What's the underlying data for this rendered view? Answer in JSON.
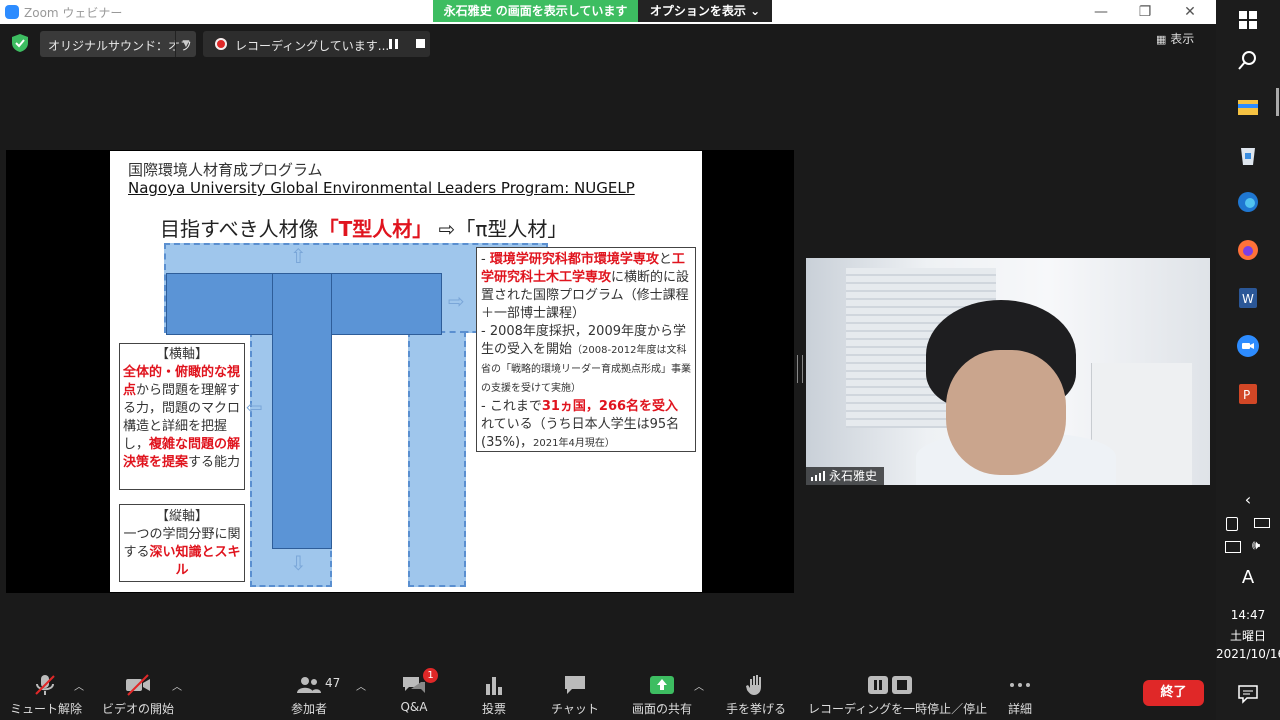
{
  "window": {
    "title": "Zoom ウェビナー",
    "share_banner": "永石雅史 の画面を表示しています",
    "options_label": "オプションを表示"
  },
  "meeting_toolbar": {
    "audio_label": "オリジナルサウンド：オフ",
    "recording_label": "レコーディングしています...",
    "view_label": "表示"
  },
  "slide": {
    "title_jp": "国際環境人材育成プログラム",
    "title_en": "Nagoya University Global Environmental Leaders Program: NUGELP",
    "heading_prefix": "目指すべき人材像",
    "heading_red": "「T型人材」",
    "heading_arrow": "⇨",
    "heading_suffix": "「π型人材」",
    "horizontal_box": {
      "title": "【横軸】",
      "red1": "全体的・俯瞰的な視点",
      "text1": "から問題を理解する力，問題のマクロ構造と詳細を把握し，",
      "red2": "複雑な問題の解決策を提案",
      "text2": "する能力"
    },
    "vertical_box": {
      "title": "【縦軸】",
      "text1": "一つの学問分野に関する",
      "red1": "深い知識とスキル"
    },
    "info_box": {
      "dash1": "- ",
      "red1": "環境学研究科都市環境学専攻",
      "text1": "と",
      "red2": "工学研究科土木工学専攻",
      "text2": "に横断的に設置された国際プログラム（修士課程＋一部博士課程）",
      "text3": "- 2008年度採択，2009年度から学生の受入を開始",
      "small1": "（2008-2012年度は文科省の「戦略的環境リーダー育成拠点形成」事業の支援を受けて実施）",
      "text4": "- これまで",
      "red3": "31ヵ国，266名を受入",
      "text5": "れている（うち日本人学生は95名(35%)，",
      "small2": "2021年4月現在）"
    }
  },
  "video": {
    "participant_name": "永石雅史"
  },
  "bottom_toolbar": {
    "unmute": "ミュート解除",
    "start_video": "ビデオの開始",
    "participants": "参加者",
    "participants_count": "47",
    "qa": "Q&A",
    "qa_badge": "1",
    "polls": "投票",
    "chat": "チャット",
    "share_screen": "画面の共有",
    "raise_hand": "手を挙げる",
    "recording_control": "レコーディングを一時停止／停止",
    "more": "詳細",
    "end": "終了"
  },
  "taskbar": {
    "ime": "A",
    "time": "14:47",
    "weekday": "土曜日",
    "date": "2021/10/16"
  },
  "colors": {
    "share_green": "#3dbd61",
    "end_red": "#e02828",
    "slide_red": "#e0141e",
    "t_blue": "#5b94d6"
  }
}
